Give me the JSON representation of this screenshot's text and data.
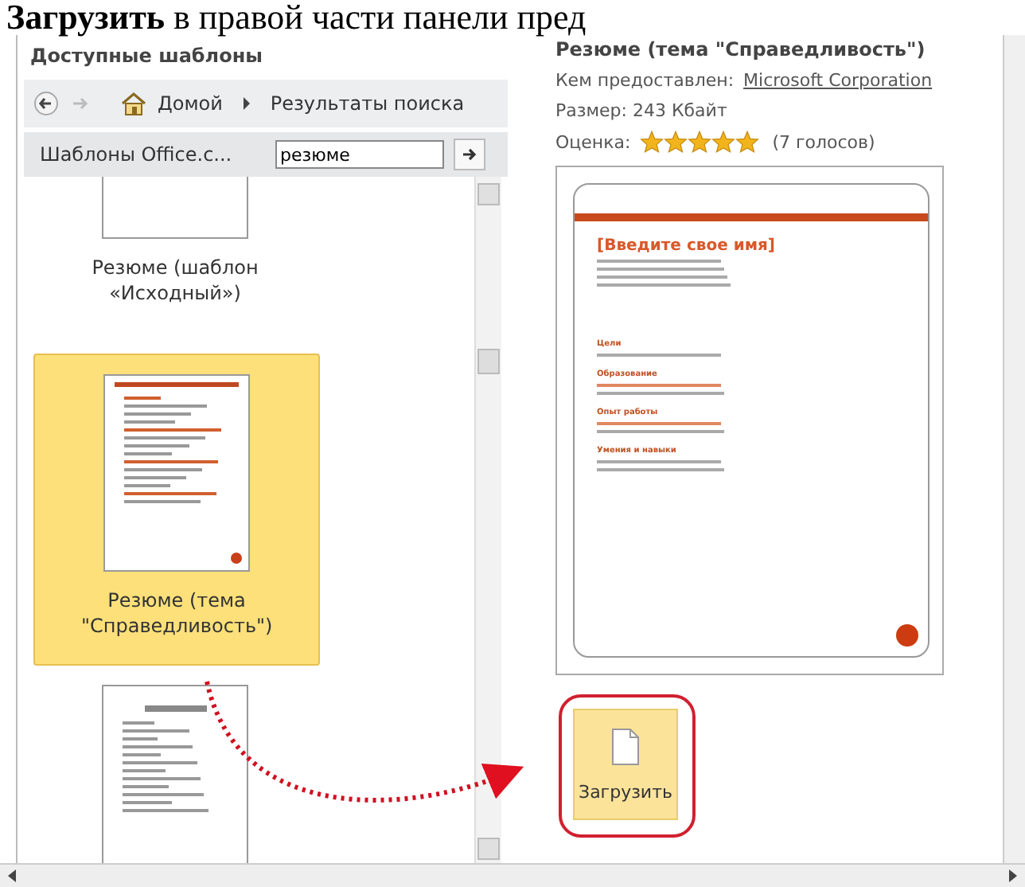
{
  "document_text": "**Загрузить** в правой части панели пред",
  "left_panel": {
    "title": "Доступные шаблоны",
    "nav": {
      "home": "Домой",
      "breadcrumb": "Результаты поиска"
    },
    "search": {
      "source": "Шаблоны Office.c...",
      "value": "резюме"
    },
    "templates": [
      {
        "kind": "plain",
        "label": "Резюме (шаблон «Исходный»)",
        "selected": false
      },
      {
        "kind": "orange",
        "label": "Резюме (тема \"Справедливость\")",
        "selected": true
      },
      {
        "kind": "classic",
        "selected": false
      }
    ]
  },
  "details": {
    "title": "Резюме (тема \"Справедливость\")",
    "provider_label": "Кем предоставлен:",
    "provider": "Microsoft Corporation",
    "size": "Размер: 243 Кбайт",
    "rating_label": "Оценка:",
    "stars": 5,
    "votes": "(7 голосов)",
    "preview": {
      "name": "[Введите свое имя]",
      "sections": [
        "Цели",
        "Образование",
        "Опыт работы",
        "Умения и навыки"
      ]
    },
    "download_button": {
      "label": "Загрузить",
      "highlighted": true
    }
  },
  "callout_arrow": true
}
